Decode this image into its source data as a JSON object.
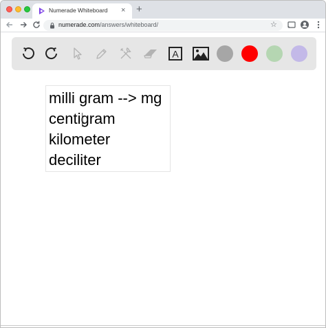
{
  "browser": {
    "tab_title": "Numerade Whiteboard",
    "tab_close": "×",
    "new_tab": "+",
    "url_host": "numerade.com",
    "url_path": "/answers/whiteboard/"
  },
  "whiteboard": {
    "tools": [
      {
        "name": "undo-icon",
        "enabled": true
      },
      {
        "name": "redo-icon",
        "enabled": true
      },
      {
        "name": "select-cursor-icon",
        "enabled": false
      },
      {
        "name": "pen-icon",
        "enabled": false
      },
      {
        "name": "tools-icon",
        "enabled": false
      },
      {
        "name": "eraser-icon",
        "enabled": false
      },
      {
        "name": "text-icon",
        "enabled": true
      },
      {
        "name": "image-icon",
        "enabled": true
      }
    ],
    "text_tool_glyph": "A",
    "colors": [
      "#a6a6a6",
      "#ff0000",
      "#b5d6b2",
      "#c3b9e8"
    ],
    "text_lines": [
      "milli gram --> mg",
      "centigram",
      "kilometer",
      "deciliter"
    ]
  }
}
